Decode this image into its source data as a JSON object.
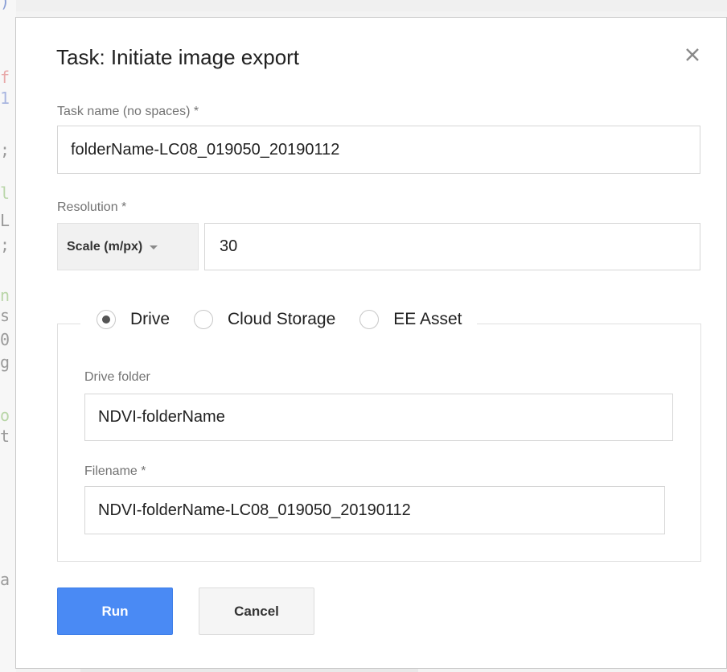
{
  "dialog": {
    "title": "Task: Initiate image export",
    "close_icon": "close-icon",
    "task_name": {
      "label": "Task name (no spaces) *",
      "value": "folderName-LC08_019050_20190112"
    },
    "resolution": {
      "label": "Resolution *",
      "mode": "Scale (m/px)",
      "value": "30"
    },
    "destination": {
      "options": [
        {
          "label": "Drive",
          "checked": true
        },
        {
          "label": "Cloud Storage",
          "checked": false
        },
        {
          "label": "EE Asset",
          "checked": false
        }
      ]
    },
    "drive_folder": {
      "label": "Drive folder",
      "value": "NDVI-folderName"
    },
    "filename": {
      "label": "Filename *",
      "value": "NDVI-folderName-LC08_019050_20190112"
    },
    "buttons": {
      "run": "Run",
      "cancel": "Cancel"
    }
  },
  "colors": {
    "primary_button": "#4a8af4",
    "title_text": "#212121",
    "label_text": "#737373"
  }
}
